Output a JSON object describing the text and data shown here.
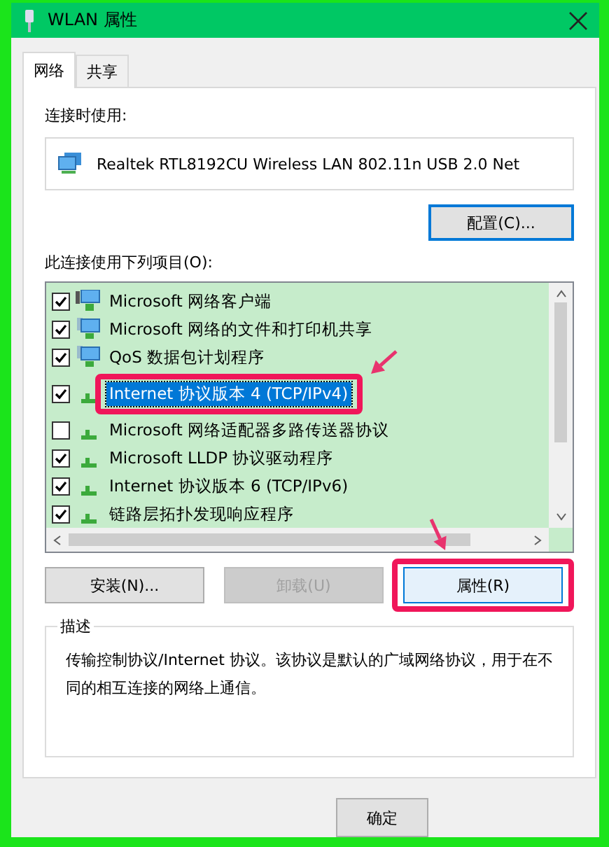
{
  "window": {
    "title": "WLAN 属性"
  },
  "tabs": [
    {
      "label": "网络",
      "selected": true
    },
    {
      "label": "共享",
      "selected": false
    }
  ],
  "connect_label": "连接时使用:",
  "adapter": "Realtek RTL8192CU Wireless LAN 802.11n USB 2.0 Net",
  "configure_button": {
    "label": "配置(C)...",
    "focused": true
  },
  "items_label": "此连接使用下列项目(O):",
  "items": [
    {
      "label": "Microsoft 网络客户端",
      "checked": true,
      "selected": false,
      "kind": "client"
    },
    {
      "label": "Microsoft 网络的文件和打印机共享",
      "checked": true,
      "selected": false,
      "kind": "service"
    },
    {
      "label": "QoS 数据包计划程序",
      "checked": true,
      "selected": false,
      "kind": "service"
    },
    {
      "label": "Internet 协议版本 4 (TCP/IPv4)",
      "checked": true,
      "selected": true,
      "kind": "protocol"
    },
    {
      "label": "Microsoft 网络适配器多路传送器协议",
      "checked": false,
      "selected": false,
      "kind": "protocol"
    },
    {
      "label": "Microsoft LLDP 协议驱动程序",
      "checked": true,
      "selected": false,
      "kind": "protocol"
    },
    {
      "label": "Internet 协议版本 6 (TCP/IPv6)",
      "checked": true,
      "selected": false,
      "kind": "protocol"
    },
    {
      "label": "链路层拓扑发现响应程序",
      "checked": true,
      "selected": false,
      "kind": "protocol"
    }
  ],
  "buttons": [
    {
      "label": "安装(N)...",
      "disabled": false,
      "highlighted": false
    },
    {
      "label": "卸载(U)",
      "disabled": true,
      "highlighted": false
    },
    {
      "label": "属性(R)",
      "disabled": false,
      "highlighted": true
    }
  ],
  "description": {
    "title": "描述",
    "text": "传输控制协议/Internet 协议。该协议是默认的广域网络协议，用于在不同的相互连接的网络上通信。"
  },
  "footer_buttons": [
    "确定"
  ]
}
